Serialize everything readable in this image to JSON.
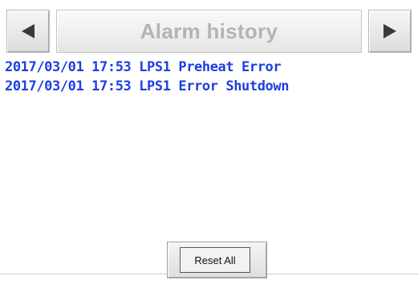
{
  "header": {
    "title": "Alarm history",
    "prev_icon": "left-triangle-icon",
    "next_icon": "right-triangle-icon"
  },
  "alarms": [
    {
      "text": "2017/03/01 17:53 LPS1 Preheat Error"
    },
    {
      "text": "2017/03/01 17:53 LPS1 Error Shutdown"
    }
  ],
  "footer": {
    "reset_label": "Reset All"
  },
  "colors": {
    "alarm_text": "#1c3fe0",
    "title_text": "#b4b4b4"
  }
}
